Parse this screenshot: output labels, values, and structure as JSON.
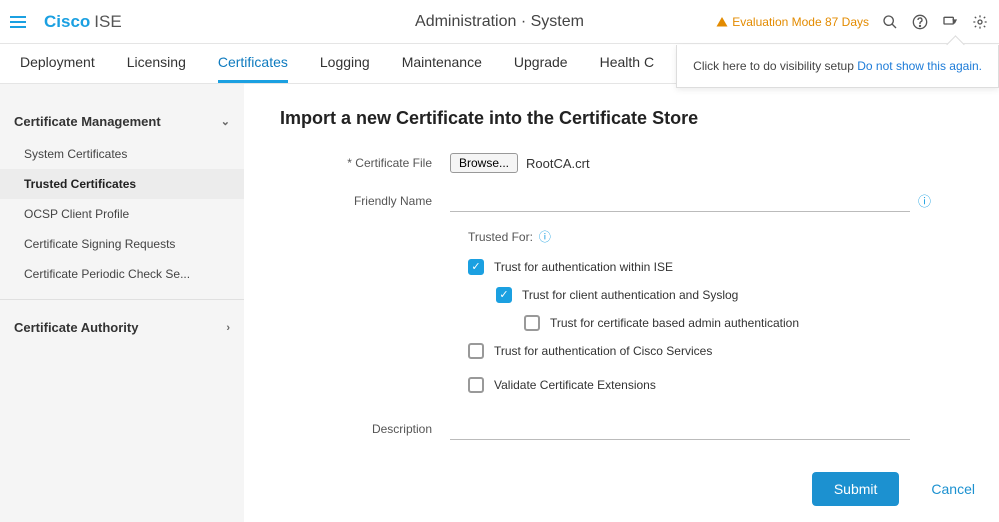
{
  "header": {
    "brand_primary": "Cisco",
    "brand_secondary": "ISE",
    "breadcrumb": "Administration · System",
    "eval_text": "Evaluation Mode 87 Days"
  },
  "popup": {
    "text": "Click here to do visibility setup ",
    "link": "Do not show this again."
  },
  "tabs": [
    "Deployment",
    "Licensing",
    "Certificates",
    "Logging",
    "Maintenance",
    "Upgrade",
    "Health C"
  ],
  "active_tab": "Certificates",
  "sidebar": {
    "group1_title": "Certificate Management",
    "group1_items": [
      "System Certificates",
      "Trusted Certificates",
      "OCSP Client Profile",
      "Certificate Signing Requests",
      "Certificate Periodic Check Se..."
    ],
    "group1_active": "Trusted Certificates",
    "group2_title": "Certificate Authority"
  },
  "page": {
    "title": "Import a new Certificate into the Certificate Store",
    "labels": {
      "cert_file": "* Certificate File",
      "browse": "Browse...",
      "file_name": "RootCA.crt",
      "friendly": "Friendly Name",
      "trusted_for": "Trusted For:",
      "description": "Description"
    },
    "checkboxes": {
      "c1": {
        "label": "Trust for authentication within ISE",
        "checked": true
      },
      "c2": {
        "label": "Trust for client authentication and Syslog",
        "checked": true
      },
      "c3": {
        "label": "Trust for certificate based admin authentication",
        "checked": false
      },
      "c4": {
        "label": "Trust for authentication of Cisco Services",
        "checked": false
      },
      "c5": {
        "label": "Validate Certificate Extensions",
        "checked": false
      }
    },
    "buttons": {
      "submit": "Submit",
      "cancel": "Cancel"
    }
  }
}
